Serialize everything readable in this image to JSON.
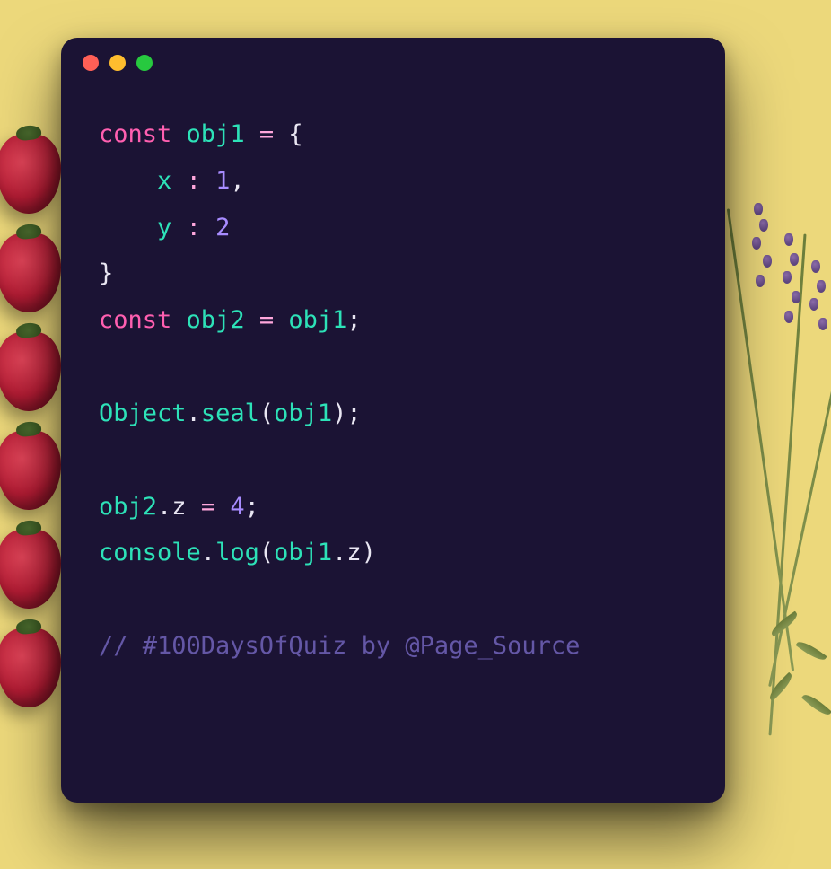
{
  "code": {
    "l1": {
      "kw": "const",
      "id": "obj1",
      "eq": "=",
      "brace": "{"
    },
    "l2": {
      "key": "x",
      "colon": ":",
      "val": "1",
      "comma": ","
    },
    "l3": {
      "key": "y",
      "colon": ":",
      "val": "2"
    },
    "l4": {
      "brace": "}"
    },
    "l5": {
      "kw": "const",
      "id": "obj2",
      "eq": "=",
      "rhs": "obj1",
      "semi": ";"
    },
    "l6": {
      "obj": "Object",
      "dot": ".",
      "fn": "seal",
      "lp": "(",
      "arg": "obj1",
      "rp": ")",
      "semi": ";"
    },
    "l7": {
      "obj": "obj2",
      "dot": ".",
      "prop": "z",
      "eq": "=",
      "val": "4",
      "semi": ";"
    },
    "l8": {
      "obj": "console",
      "dot1": ".",
      "fn": "log",
      "lp": "(",
      "arg1": "obj1",
      "dot2": ".",
      "arg2": "z",
      "rp": ")"
    },
    "comment": "// #100DaysOfQuiz by @Page_Source"
  }
}
